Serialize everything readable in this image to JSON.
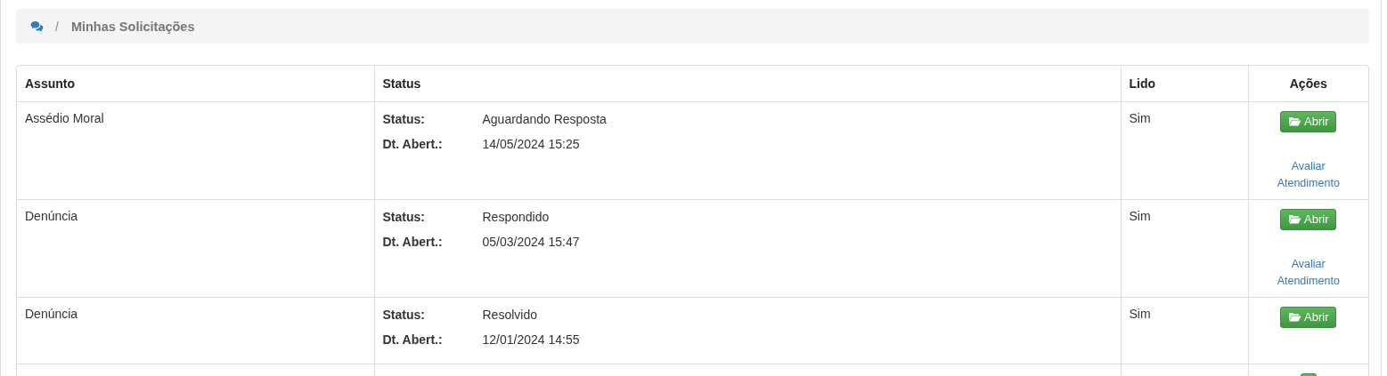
{
  "breadcrumb": {
    "separator": "/",
    "items": [
      "Minhas Solicitações"
    ]
  },
  "table": {
    "columns": [
      "Assunto",
      "Status",
      "Lido",
      "Ações"
    ],
    "rows": [
      {
        "subject": "Assédio Moral",
        "status_label": "Status:",
        "status": "Aguardando Resposta",
        "date_label": "Dt. Abert.:",
        "date": "14/05/2024 15:25",
        "read": "Sim",
        "open_button": "Abrir",
        "rate_link": "Avaliar Atendimento"
      },
      {
        "subject": "Denúncia",
        "status_label": "Status:",
        "status": "Respondido",
        "date_label": "Dt. Abert.:",
        "date": "05/03/2024 15:47",
        "read": "Sim",
        "open_button": "Abrir",
        "rate_link": "Avaliar Atendimento"
      },
      {
        "subject": "Denúncia",
        "status_label": "Status:",
        "status": "Resolvido",
        "date_label": "Dt. Abert.:",
        "date": "12/01/2024 14:55",
        "read": "Sim",
        "open_button": "Abrir"
      },
      {
        "partial": true
      }
    ]
  }
}
